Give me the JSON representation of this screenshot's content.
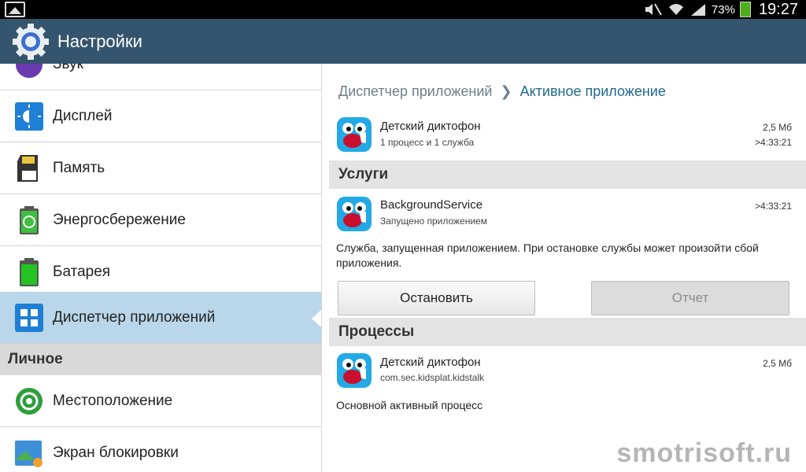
{
  "status_bar": {
    "battery_percent": "73%",
    "time": "19:27"
  },
  "action_bar": {
    "title": "Настройки"
  },
  "sidebar": {
    "items": [
      {
        "label": "Звук",
        "icon": "sound-icon"
      },
      {
        "label": "Дисплей",
        "icon": "display-icon"
      },
      {
        "label": "Память",
        "icon": "memory-icon"
      },
      {
        "label": "Энергосбережение",
        "icon": "power-saving-icon"
      },
      {
        "label": "Батарея",
        "icon": "battery-icon"
      },
      {
        "label": "Диспетчер приложений",
        "icon": "app-manager-icon",
        "selected": true
      }
    ],
    "section": "Личное",
    "personal_items": [
      {
        "label": "Местоположение",
        "icon": "location-icon"
      },
      {
        "label": "Экран блокировки",
        "icon": "lock-screen-icon"
      }
    ]
  },
  "breadcrumb": {
    "parent": "Диспетчер приложений",
    "current": "Активное приложение"
  },
  "app": {
    "name": "Детский диктофон",
    "summary": "1 процесс и 1 служба",
    "size": "2,5 Мб",
    "time": ">4:33:21"
  },
  "services": {
    "header": "Услуги",
    "name": "BackgroundService",
    "sub": "Запущено приложением",
    "time": ">4:33:21",
    "description": "Служба, запущенная приложением. При остановке службы может произойти сбой приложения.",
    "stop_label": "Остановить",
    "report_label": "Отчет"
  },
  "processes": {
    "header": "Процессы",
    "name": "Детский диктофон",
    "package": "com.sec.kidsplat.kidstalk",
    "size": "2,5 Мб",
    "description": "Основной активный процесс"
  },
  "watermark": "smotrisoft.ru",
  "colors": {
    "action_bar": "#35556e",
    "selected": "#b9d6ea",
    "accent": "#1f6a8f"
  }
}
